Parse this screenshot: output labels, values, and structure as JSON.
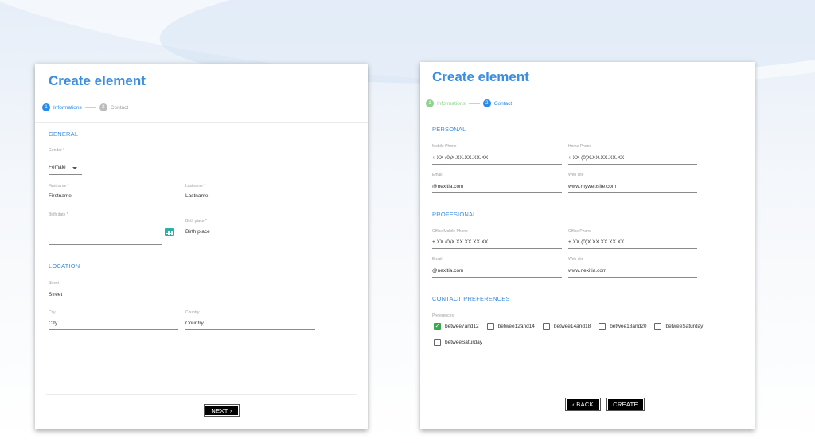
{
  "left_form": {
    "title": "Create element",
    "stepper": [
      {
        "number": "1",
        "label": "Informations",
        "state": "active"
      },
      {
        "number": "2",
        "label": "Contact",
        "state": "inactive"
      }
    ],
    "general": {
      "section_title": "GENERAL",
      "gender": {
        "label": "Gender *",
        "value": "Female"
      },
      "firstname": {
        "label": "Firstname *",
        "value": "Firstname"
      },
      "lastname": {
        "label": "Lastname *",
        "value": "Lastname"
      },
      "birth_date": {
        "label": "Birth date *",
        "value": ""
      },
      "birth_place": {
        "label": "Birth place *",
        "value": "Birth place"
      }
    },
    "location": {
      "section_title": "LOCATION",
      "street": {
        "label": "Street",
        "value": "Street"
      },
      "city": {
        "label": "City",
        "value": "City"
      },
      "country": {
        "label": "Country",
        "value": "Country"
      }
    },
    "next_label": "NEXT ›"
  },
  "right_form": {
    "title": "Create element",
    "stepper": [
      {
        "number": "1",
        "label": "Informations",
        "state": "done"
      },
      {
        "number": "2",
        "label": "Contact",
        "state": "active"
      }
    ],
    "personal": {
      "section_title": "PERSONAL",
      "mobile_phone": {
        "label": "Mobile Phone",
        "value": "+ XX (0)X.XX.XX.XX.XX"
      },
      "home_phone": {
        "label": "Home Phone",
        "value": "+ XX (0)X.XX.XX.XX.XX"
      },
      "email": {
        "label": "Email",
        "value": "@nexitia.com"
      },
      "website": {
        "label": "Web site",
        "value": "www.mywebsite.com"
      }
    },
    "professional": {
      "section_title": "PROFESIONAL",
      "office_mobile_phone": {
        "label": "Office Mobile Phone",
        "value": "+ XX (0)X.XX.XX.XX.XX"
      },
      "office_phone": {
        "label": "Office Phone",
        "value": "+ XX (0)X.XX.XX.XX.XX"
      },
      "email": {
        "label": "Email",
        "value": "@nexitia.com"
      },
      "website": {
        "label": "Web site",
        "value": "www.nexitia.com"
      }
    },
    "contact_preferences": {
      "section_title": "CONTACT PREFERENCES",
      "label": "Preferences",
      "options": [
        {
          "label": "betwee7and12",
          "checked": true
        },
        {
          "label": "betwee12and14",
          "checked": false
        },
        {
          "label": "betwee14and18",
          "checked": false
        },
        {
          "label": "betwee18and20",
          "checked": false
        },
        {
          "label": "betweeSaturday",
          "checked": false
        },
        {
          "label": "betweeSaturday",
          "checked": false
        }
      ]
    },
    "back_label": "‹ BACK",
    "create_label": "CREATE"
  },
  "colors": {
    "accent": "#3b8de0",
    "step_active": "#2a8be8",
    "step_done": "#8fd18f",
    "step_inactive": "#bdbdbd",
    "checkbox_checked": "#3aa84a",
    "calendar_icon": "#2bb0a3"
  }
}
